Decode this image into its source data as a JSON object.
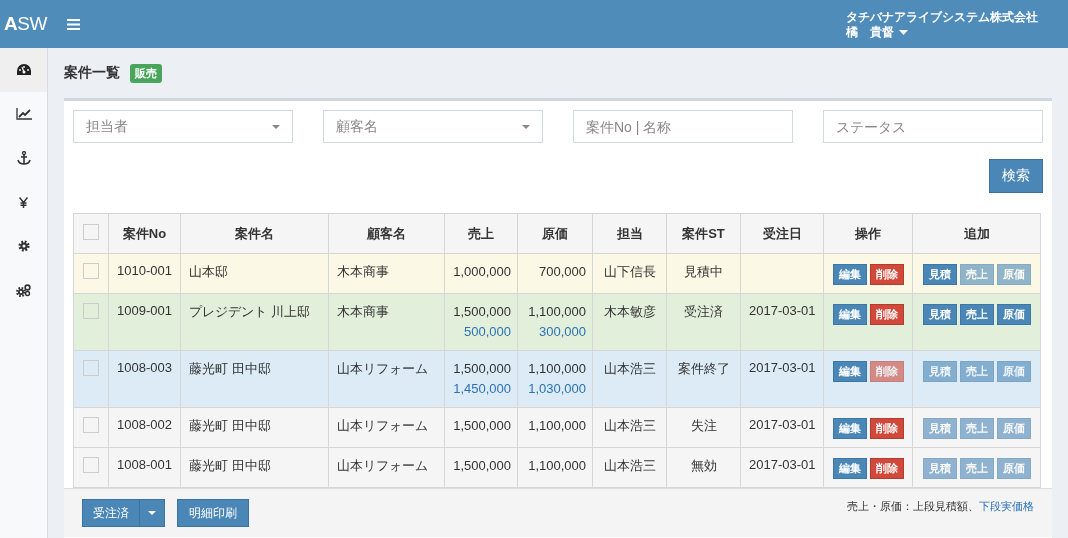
{
  "header": {
    "logo_bold": "A",
    "logo_rest": "SW",
    "company": "タチバナアライブシステム株式会社",
    "user": "橘　貴督"
  },
  "sidebar": {
    "items": [
      {
        "selected": true
      },
      {
        "selected": false
      },
      {
        "selected": false
      },
      {
        "selected": false
      },
      {
        "selected": false
      },
      {
        "selected": false
      }
    ]
  },
  "page": {
    "title": "案件一覧",
    "badge": "販売"
  },
  "filters": [
    {
      "kind": "select",
      "placeholder": "担当者"
    },
    {
      "kind": "select",
      "placeholder": "顧客名"
    },
    {
      "kind": "text",
      "placeholder": "案件No | 名称"
    },
    {
      "kind": "text",
      "placeholder": "ステータス"
    }
  ],
  "search_button": "検索",
  "table": {
    "select_all_checked": false,
    "columns": [
      "案件No",
      "案件名",
      "顧客名",
      "売上",
      "原価",
      "担当",
      "案件ST",
      "受注日",
      "操作",
      "追加"
    ],
    "rows": [
      {
        "kind": "warning",
        "checked": false,
        "no": "1010-001",
        "name": "山本邸",
        "customer": "木本商事",
        "sales": "1,000,000",
        "cost": "700,000",
        "person": "山下信長",
        "status": "見積中",
        "date": "",
        "edit": {
          "label": "編集",
          "disabled": false
        },
        "delete": {
          "label": "削除",
          "disabled": false
        },
        "add": [
          {
            "label": "見積",
            "disabled": false
          },
          {
            "label": "売上",
            "disabled": true
          },
          {
            "label": "原価",
            "disabled": true
          }
        ]
      },
      {
        "kind": "success",
        "checked": false,
        "no": "1009-001",
        "name": "プレジデント 川上邸",
        "customer": "木本商事",
        "sales": "1,500,000",
        "sales_actual": "500,000",
        "cost": "1,100,000",
        "cost_actual": "300,000",
        "person": "木本敏彦",
        "status": "受注済",
        "date": "2017-03-01",
        "edit": {
          "label": "編集",
          "disabled": false
        },
        "delete": {
          "label": "削除",
          "disabled": false
        },
        "add": [
          {
            "label": "見積",
            "disabled": false
          },
          {
            "label": "売上",
            "disabled": false
          },
          {
            "label": "原価",
            "disabled": false
          }
        ]
      },
      {
        "kind": "info",
        "checked": false,
        "no": "1008-003",
        "name": "藤光町 田中邸",
        "customer": "山本リフォーム",
        "sales": "1,500,000",
        "sales_actual": "1,450,000",
        "cost": "1,100,000",
        "cost_actual": "1,030,000",
        "person": "山本浩三",
        "status": "案件終了",
        "date": "2017-03-01",
        "edit": {
          "label": "編集",
          "disabled": false
        },
        "delete": {
          "label": "削除",
          "disabled": true
        },
        "add": [
          {
            "label": "見積",
            "disabled": true
          },
          {
            "label": "売上",
            "disabled": true
          },
          {
            "label": "原価",
            "disabled": true
          }
        ]
      },
      {
        "kind": "default",
        "checked": false,
        "no": "1008-002",
        "name": "藤光町 田中邸",
        "customer": "山本リフォーム",
        "sales": "1,500,000",
        "cost": "1,100,000",
        "person": "山本浩三",
        "status": "失注",
        "date": "2017-03-01",
        "edit": {
          "label": "編集",
          "disabled": false
        },
        "delete": {
          "label": "削除",
          "disabled": false
        },
        "add": [
          {
            "label": "見積",
            "disabled": true
          },
          {
            "label": "売上",
            "disabled": true
          },
          {
            "label": "原価",
            "disabled": true
          }
        ]
      },
      {
        "kind": "default",
        "checked": false,
        "no": "1008-001",
        "name": "藤光町 田中邸",
        "customer": "山本リフォーム",
        "sales": "1,500,000",
        "cost": "1,100,000",
        "person": "山本浩三",
        "status": "無効",
        "date": "2017-03-01",
        "edit": {
          "label": "編集",
          "disabled": false
        },
        "delete": {
          "label": "削除",
          "disabled": false
        },
        "add": [
          {
            "label": "見積",
            "disabled": true
          },
          {
            "label": "売上",
            "disabled": true
          },
          {
            "label": "原価",
            "disabled": true
          }
        ]
      }
    ]
  },
  "footer": {
    "split_button": "受注済",
    "print_button": "明細印刷",
    "note": "売上・原価：上段見積額、",
    "note_highlight": "下段実価格"
  }
}
